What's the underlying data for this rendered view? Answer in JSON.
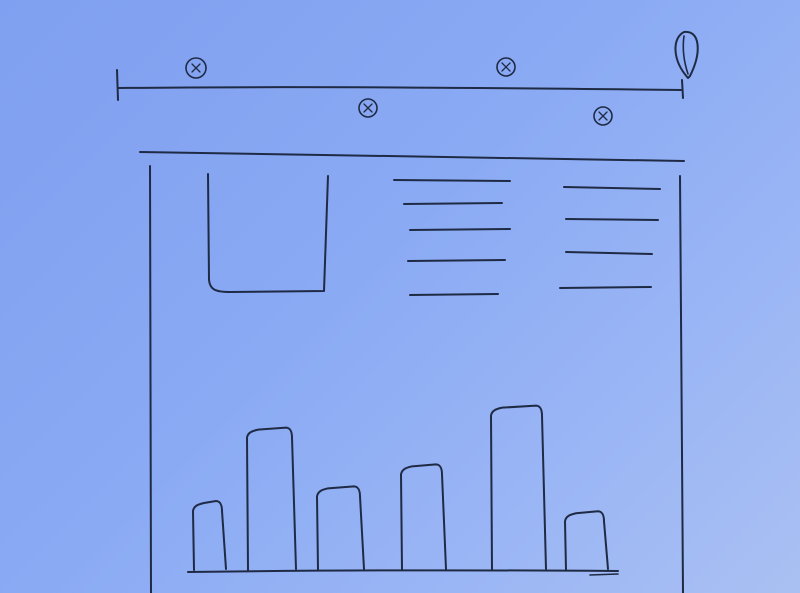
{
  "sketch": {
    "ink_color": "#1f2a44",
    "paper_color": "#8aaaf4",
    "timeline": {
      "markers": [
        {
          "side": "above",
          "glyph": "x"
        },
        {
          "side": "below",
          "glyph": "x"
        },
        {
          "side": "above",
          "glyph": "x"
        },
        {
          "side": "below",
          "glyph": "x"
        }
      ],
      "end_icon": "pin-icon"
    },
    "panel": {
      "image_placeholder": true,
      "text_columns": [
        {
          "lines": 5
        },
        {
          "lines": 4
        }
      ]
    }
  },
  "chart_data": {
    "type": "bar",
    "categories": [
      "",
      "",
      "",
      "",
      "",
      ""
    ],
    "values": [
      45,
      95,
      55,
      70,
      110,
      38
    ],
    "ylim": [
      0,
      120
    ],
    "title": "",
    "xlabel": "",
    "ylabel": ""
  }
}
